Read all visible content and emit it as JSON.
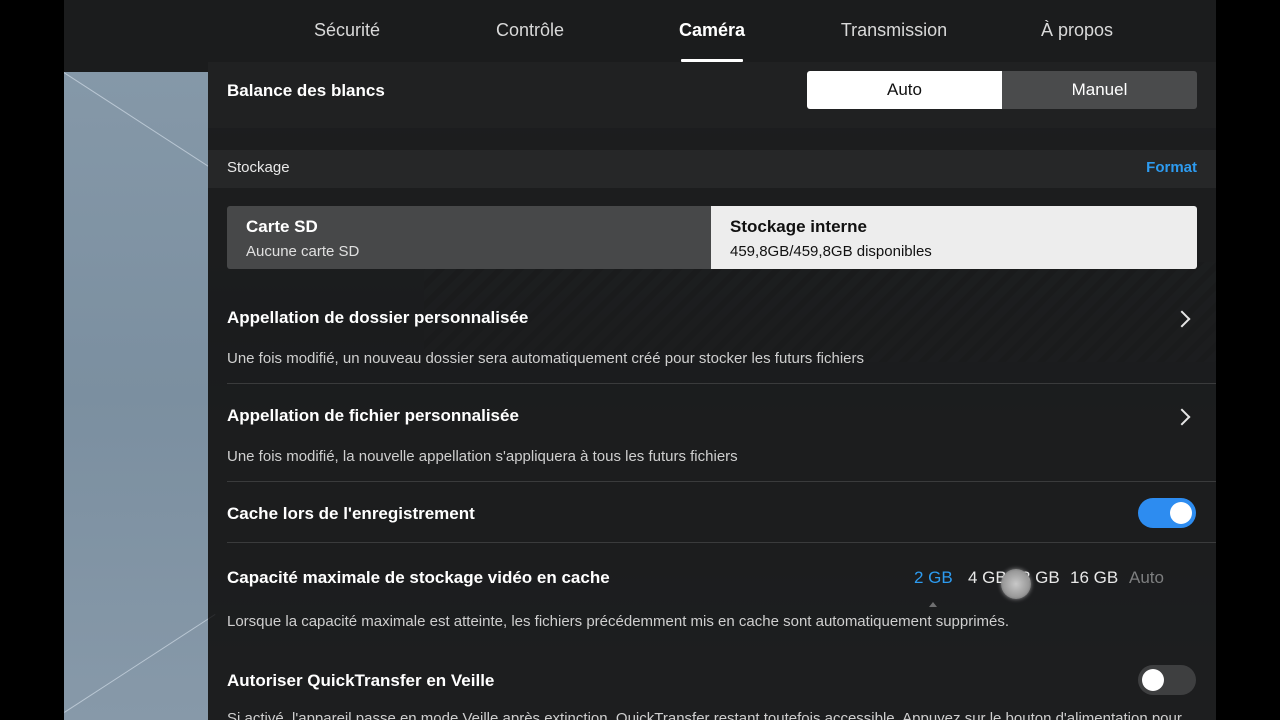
{
  "tabs": [
    {
      "label": "Sécurité",
      "active": false
    },
    {
      "label": "Contrôle",
      "active": false
    },
    {
      "label": "Caméra",
      "active": true
    },
    {
      "label": "Transmission",
      "active": false
    },
    {
      "label": "À propos",
      "active": false
    }
  ],
  "white_balance": {
    "title": "Balance des blancs",
    "options": [
      "Auto",
      "Manuel"
    ],
    "selected": "Auto"
  },
  "storage": {
    "label": "Stockage",
    "format_label": "Format",
    "sd_card": {
      "title": "Carte SD",
      "subtitle": "Aucune carte SD"
    },
    "internal": {
      "title": "Stockage interne",
      "subtitle": "459,8GB/459,8GB disponibles"
    },
    "selected": "internal"
  },
  "folder_naming": {
    "title": "Appellation de dossier personnalisée",
    "description": "Une fois modifié, un nouveau dossier sera automatiquement créé pour stocker les futurs fichiers"
  },
  "file_naming": {
    "title": "Appellation de fichier personnalisée",
    "description": "Une fois modifié, la nouvelle appellation s'appliquera à tous les futurs fichiers"
  },
  "cache_recording": {
    "title": "Cache lors de l'enregistrement",
    "enabled": true
  },
  "cache_capacity": {
    "title": "Capacité maximale de stockage vidéo en cache",
    "options": [
      "2 GB",
      "4 GB",
      "8 GB",
      "16 GB",
      "Auto"
    ],
    "selected": "2 GB",
    "disabled_option": "Auto",
    "description": "Lorsque la capacité maximale est atteinte, les fichiers précédemment mis en cache sont automatiquement supprimés."
  },
  "quicktransfer": {
    "title": "Autoriser QuickTransfer en Veille",
    "enabled": false,
    "description": "Si activé, l'appareil passe en mode Veille après extinction. QuickTransfer restant toutefois accessible. Appuyez sur le bouton d'alimentation pour"
  },
  "colors": {
    "accent": "#2d9bf0",
    "toggle_on": "#2d8cf0",
    "panel_bg": "#1b1c1d"
  }
}
